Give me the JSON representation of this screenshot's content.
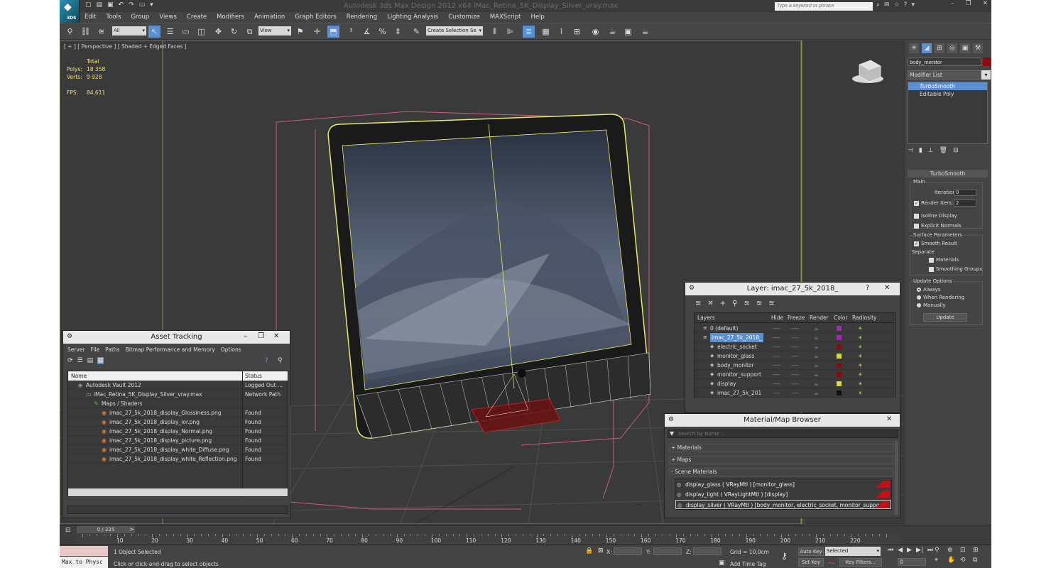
{
  "app": {
    "title": "Autodesk 3ds Max Design 2012 x64       iMac_Retina_5K_Display_Silver_vray.max",
    "search_placeholder": "Type a keyword or phrase",
    "logo_text": "3DS"
  },
  "menu": [
    "Edit",
    "Tools",
    "Group",
    "Views",
    "Create",
    "Modifiers",
    "Animation",
    "Graph Editors",
    "Rendering",
    "Lighting Analysis",
    "Customize",
    "MAXScript",
    "Help"
  ],
  "toolbar": {
    "filter_value": "All",
    "refcoord_value": "View",
    "selection_set_value": "Create Selection Se"
  },
  "viewport": {
    "label": "[ + ] [ Perspective ] [ Shaded + Edged Faces ]",
    "stats_header": "Total",
    "polys_label": "Polys:",
    "polys_value": "18 358",
    "verts_label": "Verts:",
    "verts_value": "9 928",
    "fps_label": "FPS:",
    "fps_value": "84,611"
  },
  "command_panel": {
    "object_name": "body_monitor",
    "object_color": "#8a0b0b",
    "modifier_list_label": "Modifier List",
    "stack": [
      "TurboSmooth",
      "Editable Poly"
    ],
    "rollout_title": "TurboSmooth",
    "main_group": "Main",
    "iterations_label": "Iterations:",
    "iterations_value": "0",
    "render_iters_label": "Render Iters:",
    "render_iters_value": "2",
    "isoline_label": "Isoline Display",
    "explicit_label": "Explicit Normals",
    "surface_group": "Surface Parameters",
    "smooth_result_label": "Smooth Result",
    "separate_label": "Separate",
    "materials_label": "Materials",
    "smoothing_groups_label": "Smoothing Groups",
    "update_group": "Update Options",
    "always_label": "Always",
    "when_rendering_label": "When Rendering",
    "manually_label": "Manually",
    "update_button": "Update"
  },
  "asset_tracking": {
    "title": "Asset Tracking",
    "menu": [
      "Server",
      "File",
      "Paths",
      "Bitmap Performance and Memory",
      "Options"
    ],
    "col_name": "Name",
    "col_status": "Status",
    "rows": [
      {
        "name": "Autodesk Vault 2012",
        "status": "Logged Out ...",
        "indent": 0
      },
      {
        "name": "iMac_Retina_5K_Display_Silver_vray.max",
        "status": "Network Path",
        "indent": 1
      },
      {
        "name": "Maps / Shaders",
        "status": "",
        "indent": 2
      },
      {
        "name": "imac_27_5k_2018_display_Glossiness.png",
        "status": "Found",
        "indent": 3
      },
      {
        "name": "imac_27_5k_2018_display_ior.png",
        "status": "Found",
        "indent": 3
      },
      {
        "name": "imac_27_5k_2018_display_Normal.png",
        "status": "Found",
        "indent": 3
      },
      {
        "name": "imac_27_5k_2018_display_picture.png",
        "status": "Found",
        "indent": 3
      },
      {
        "name": "imac_27_5k_2018_display_white_Diffuse.png",
        "status": "Found",
        "indent": 3
      },
      {
        "name": "imac_27_5k_2018_display_white_Reflection.png",
        "status": "Found",
        "indent": 3
      }
    ]
  },
  "layer_panel": {
    "title": "Layer: imac_27_5k_2018_",
    "help": "?",
    "columns": [
      "Layers",
      "Hide",
      "Freeze",
      "Render",
      "Color",
      "Radiosity"
    ],
    "rows": [
      {
        "name": "0 (default)",
        "color": "#9b2fae",
        "selected": false,
        "indent": 0
      },
      {
        "name": "imac_27_5k_2018_",
        "color": "#9b2fae",
        "selected": true,
        "indent": 0
      },
      {
        "name": "electric_socket",
        "color": "#8a0b0b",
        "selected": false,
        "indent": 1
      },
      {
        "name": "monitor_glass",
        "color": "#d8d84a",
        "selected": false,
        "indent": 1
      },
      {
        "name": "body_monitor",
        "color": "#8a0b0b",
        "selected": false,
        "indent": 1
      },
      {
        "name": "monitor_support",
        "color": "#8a0b0b",
        "selected": false,
        "indent": 1
      },
      {
        "name": "display",
        "color": "#d8d84a",
        "selected": false,
        "indent": 1
      },
      {
        "name": "imac_27_5k_201",
        "color": "#111111",
        "selected": false,
        "indent": 1
      }
    ]
  },
  "material_browser": {
    "title": "Material/Map Browser",
    "search_placeholder": "Search by Name ...",
    "sections": [
      "+ Materials",
      "+ Maps",
      "- Scene Materials"
    ],
    "materials": [
      "display_glass ( VRayMtl ) [monitor_glass]",
      "display_light ( VRayLightMtl ) [display]",
      "display_silver ( VRayMtl ) [body_monitor, electric_socket, monitor_support]"
    ]
  },
  "timeline": {
    "slider_label": "0 / 225",
    "ticks": [
      "10",
      "20",
      "30",
      "40",
      "50",
      "60",
      "70",
      "80",
      "90",
      "100",
      "110",
      "120",
      "130",
      "140",
      "150",
      "160",
      "170",
      "180",
      "190",
      "200",
      "210",
      "220"
    ]
  },
  "status": {
    "script_listener": "Max to Physc",
    "selected_text": "1 Object Selected",
    "prompt_text": "Click or click-and-drag to select objects",
    "x_label": "X:",
    "y_label": "Y:",
    "z_label": "Z:",
    "grid_text": "Grid = 10,0cm",
    "add_time_tag": "Add Time Tag",
    "auto_key": "Auto Key",
    "set_key": "Set Key",
    "selected_dropdown": "Selected",
    "key_filters": "Key Filters...",
    "frame_value": "0"
  }
}
